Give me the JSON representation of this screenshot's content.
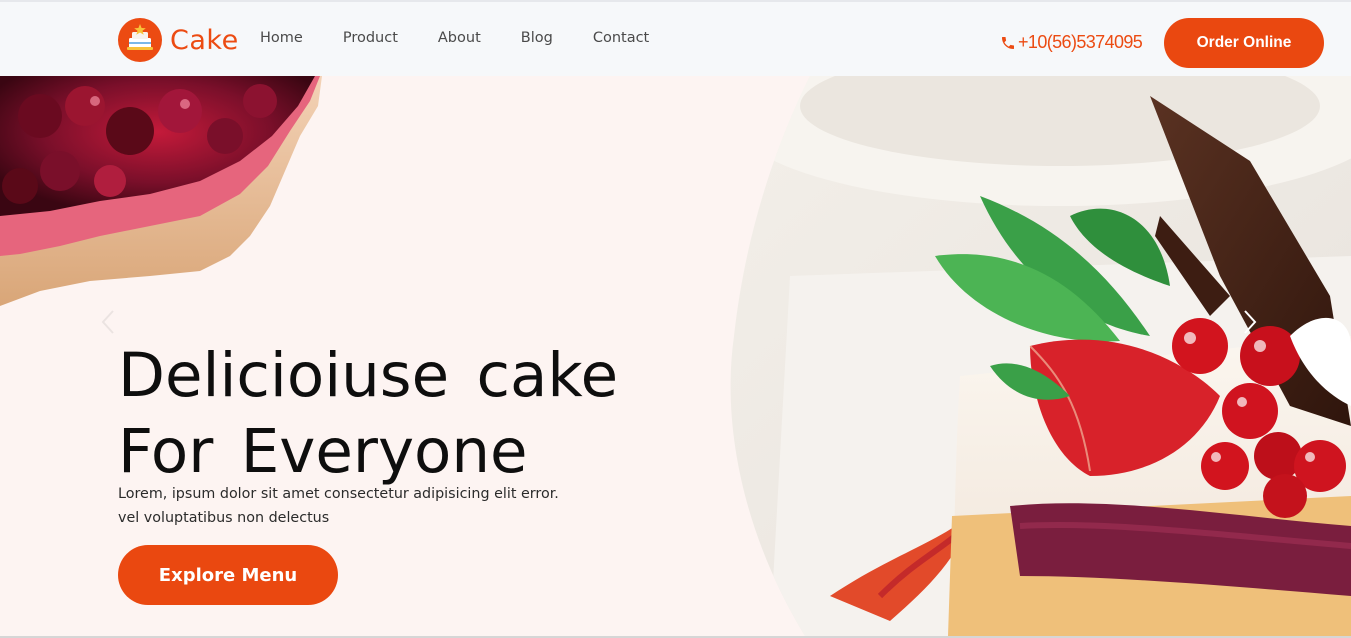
{
  "header": {
    "brand": "Cake",
    "nav": [
      "Home",
      "Product",
      "About",
      "Blog",
      "Contact"
    ],
    "phone": "+10(56)5374095",
    "order_label": "Order Online"
  },
  "hero": {
    "title_line1": "Delicioiuse cake",
    "title_line2": "For Everyone",
    "desc_line1": "Lorem, ipsum dolor sit amet consectetur adipisicing elit error.",
    "desc_line2": "vel voluptatibus non delectus",
    "cta_label": "Explore Menu"
  },
  "icons": {
    "logo": "cake-logo-icon",
    "phone": "phone-icon",
    "next": "chevron-right-icon",
    "prev": "chevron-left-icon"
  },
  "colors": {
    "accent": "#ea4810",
    "header_bg": "#f6f8fa",
    "hero_bg": "#fdf4f2"
  }
}
